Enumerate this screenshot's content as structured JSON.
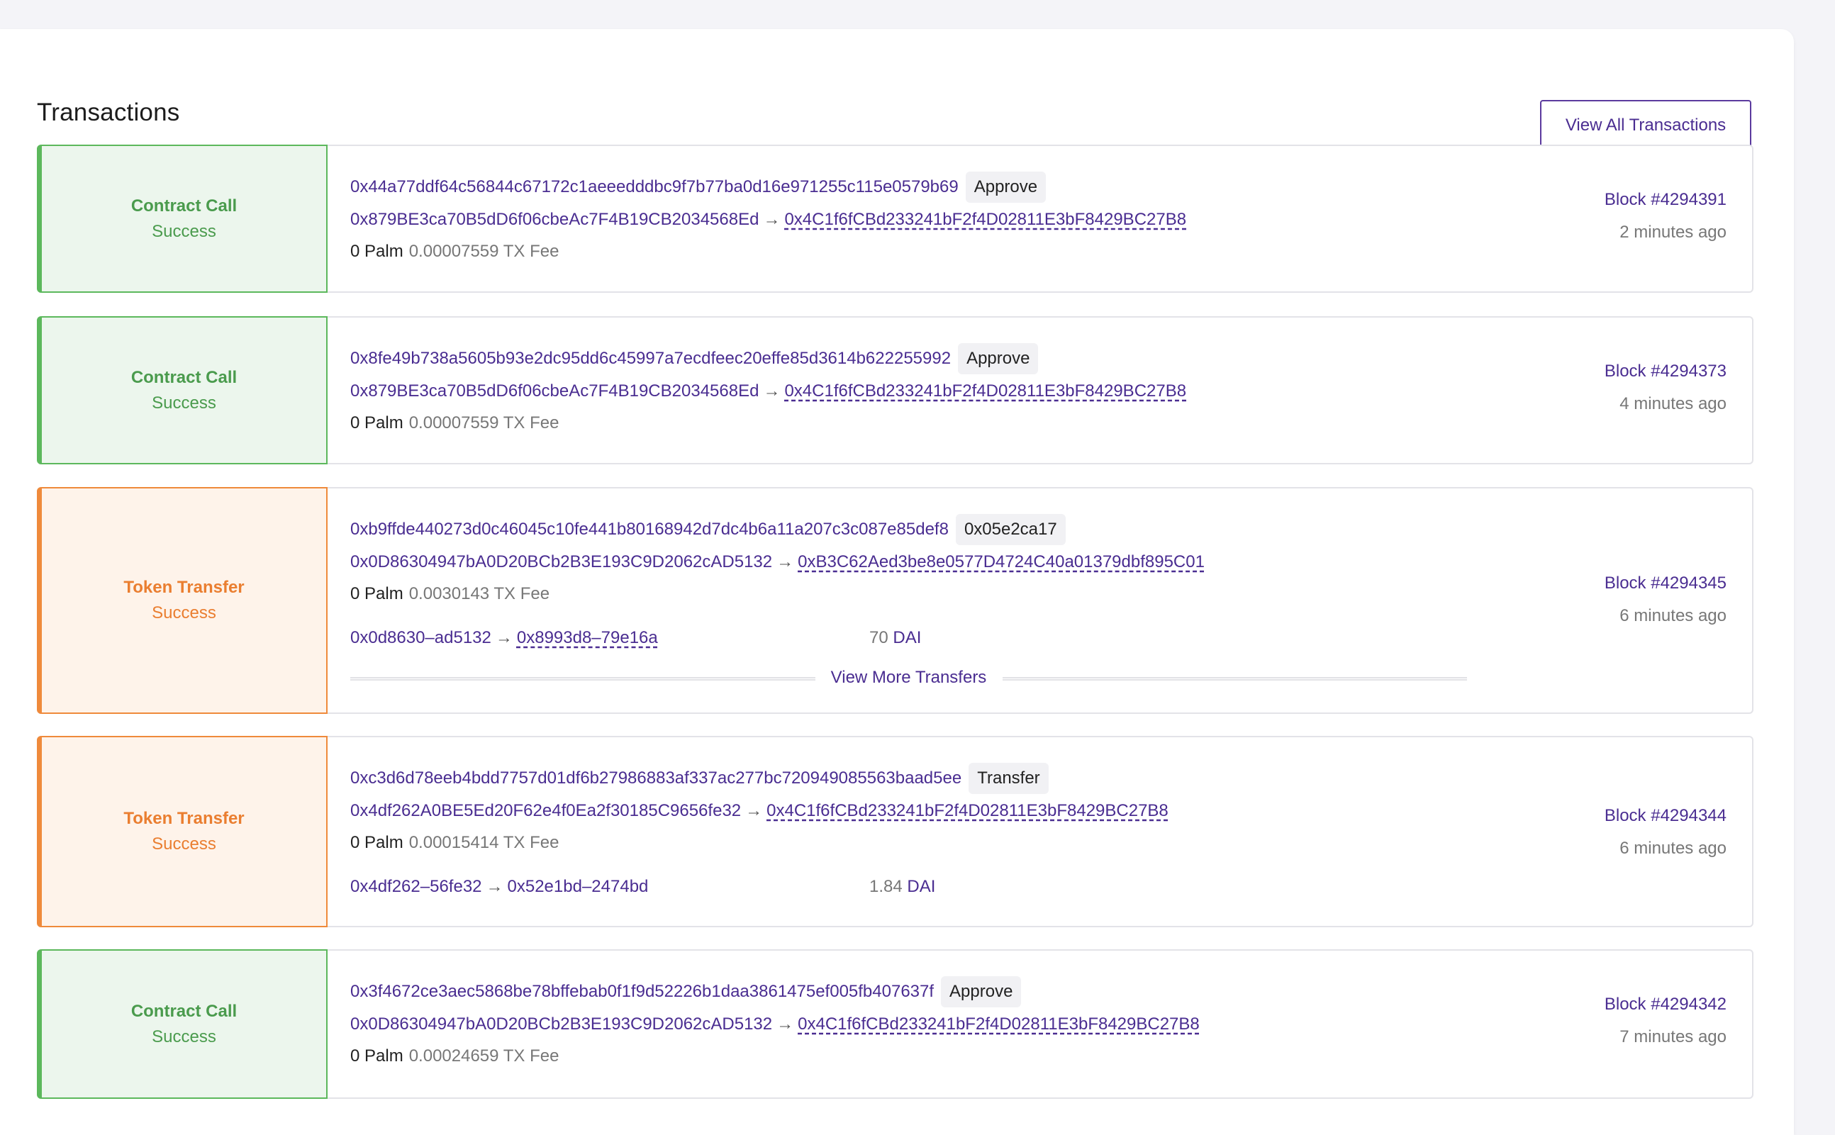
{
  "page": {
    "title": "Transactions",
    "view_all_label": "View All Transactions"
  },
  "transactions": [
    {
      "type": "Contract Call",
      "status": "Success",
      "hash": "0x44a77ddf64c56844c67172c1aeeedddbc9f7b77ba0d16e971255c115e0579b69",
      "method": "Approve",
      "from": "0x879BE3ca70B5dD6f06cbeAc7F4B19CB2034568Ed",
      "arrow": "→",
      "to": "0x4C1f6fCBd233241bF2f4D02811E3bF8429BC27B8",
      "value": "0 Palm",
      "fee": "0.00007559 TX Fee",
      "block": "Block #4294391",
      "age": "2 minutes ago"
    },
    {
      "type": "Contract Call",
      "status": "Success",
      "hash": "0x8fe49b738a5605b93e2dc95dd6c45997a7ecdfeec20effe85d3614b622255992",
      "method": "Approve",
      "from": "0x879BE3ca70B5dD6f06cbeAc7F4B19CB2034568Ed",
      "arrow": "→",
      "to": "0x4C1f6fCBd233241bF2f4D02811E3bF8429BC27B8",
      "value": "0 Palm",
      "fee": "0.00007559 TX Fee",
      "block": "Block #4294373",
      "age": "4 minutes ago"
    },
    {
      "type": "Token Transfer",
      "status": "Success",
      "hash": "0xb9ffde440273d0c46045c10fe441b80168942d7dc4b6a11a207c3c087e85def8",
      "method": "0x05e2ca17",
      "from": "0x0D86304947bA0D20BCb2B3E193C9D2062cAD5132",
      "arrow": "→",
      "to": "0xB3C62Aed3be8e0577D4724C40a01379dbf895C01",
      "value": "0 Palm",
      "fee": "0.0030143 TX Fee",
      "transfer_from": "0x0d8630–ad5132",
      "transfer_to": "0x8993d8–79e16a",
      "transfer_amount": "70",
      "transfer_token": "DAI",
      "view_more": "View More Transfers",
      "block": "Block #4294345",
      "age": "6 minutes ago"
    },
    {
      "type": "Token Transfer",
      "status": "Success",
      "hash": "0xc3d6d78eeb4bdd7757d01df6b27986883af337ac277bc720949085563baad5ee",
      "method": "Transfer",
      "from": "0x4df262A0BE5Ed20F62e4f0Ea2f30185C9656fe32",
      "arrow": "→",
      "to": "0x4C1f6fCBd233241bF2f4D02811E3bF8429BC27B8",
      "value": "0 Palm",
      "fee": "0.00015414 TX Fee",
      "transfer_from": "0x4df262–56fe32",
      "transfer_to": "0x52e1bd–2474bd",
      "transfer_amount": "1.84",
      "transfer_token": "DAI",
      "block": "Block #4294344",
      "age": "6 minutes ago"
    },
    {
      "type": "Contract Call",
      "status": "Success",
      "hash": "0x3f4672ce3aec5868be78bffebab0f1f9d52226b1daa3861475ef005fb407637f",
      "method": "Approve",
      "from": "0x0D86304947bA0D20BCb2B3E193C9D2062cAD5132",
      "arrow": "→",
      "to": "0x4C1f6fCBd233241bF2f4D02811E3bF8429BC27B8",
      "value": "0 Palm",
      "fee": "0.00024659 TX Fee",
      "block": "Block #4294342",
      "age": "7 minutes ago"
    }
  ],
  "colors": {
    "contract_call": "#4a9b4d",
    "token_transfer": "#ea7e30",
    "link": "#4a2d91"
  }
}
